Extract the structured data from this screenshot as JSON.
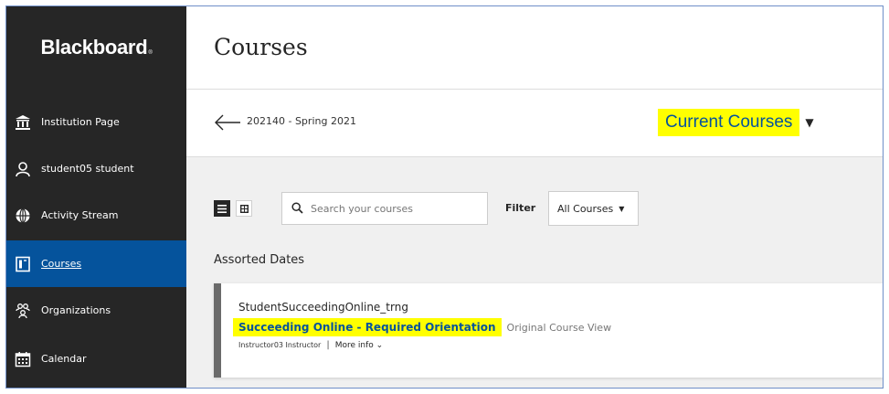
{
  "brand": {
    "name": "Blackboard",
    "mark": "®"
  },
  "sidebar": {
    "items": [
      {
        "label": "Institution Page",
        "icon": "institution-icon"
      },
      {
        "label": "student05 student",
        "icon": "user-icon"
      },
      {
        "label": "Activity Stream",
        "icon": "globe-icon"
      },
      {
        "label": "Courses",
        "icon": "courses-icon",
        "active": true
      },
      {
        "label": "Organizations",
        "icon": "organizations-icon"
      },
      {
        "label": "Calendar",
        "icon": "calendar-icon"
      }
    ]
  },
  "header": {
    "title": "Courses"
  },
  "termbar": {
    "term": "202140 - Spring 2021",
    "current_courses": "Current Courses"
  },
  "toolbar": {
    "search_placeholder": "Search your courses",
    "filter_label": "Filter",
    "filter_value": "All Courses"
  },
  "section": {
    "heading": "Assorted Dates"
  },
  "course": {
    "id": "StudentSucceedingOnline_trng",
    "name": "Succeeding Online - Required Orientation",
    "view": "Original Course View",
    "instructor": "Instructor03 Instructor",
    "separator": "|",
    "more_info": "More info"
  },
  "colors": {
    "sidebar": "#262626",
    "active": "#05539c",
    "highlight": "#ffff00",
    "link": "#05539c"
  }
}
